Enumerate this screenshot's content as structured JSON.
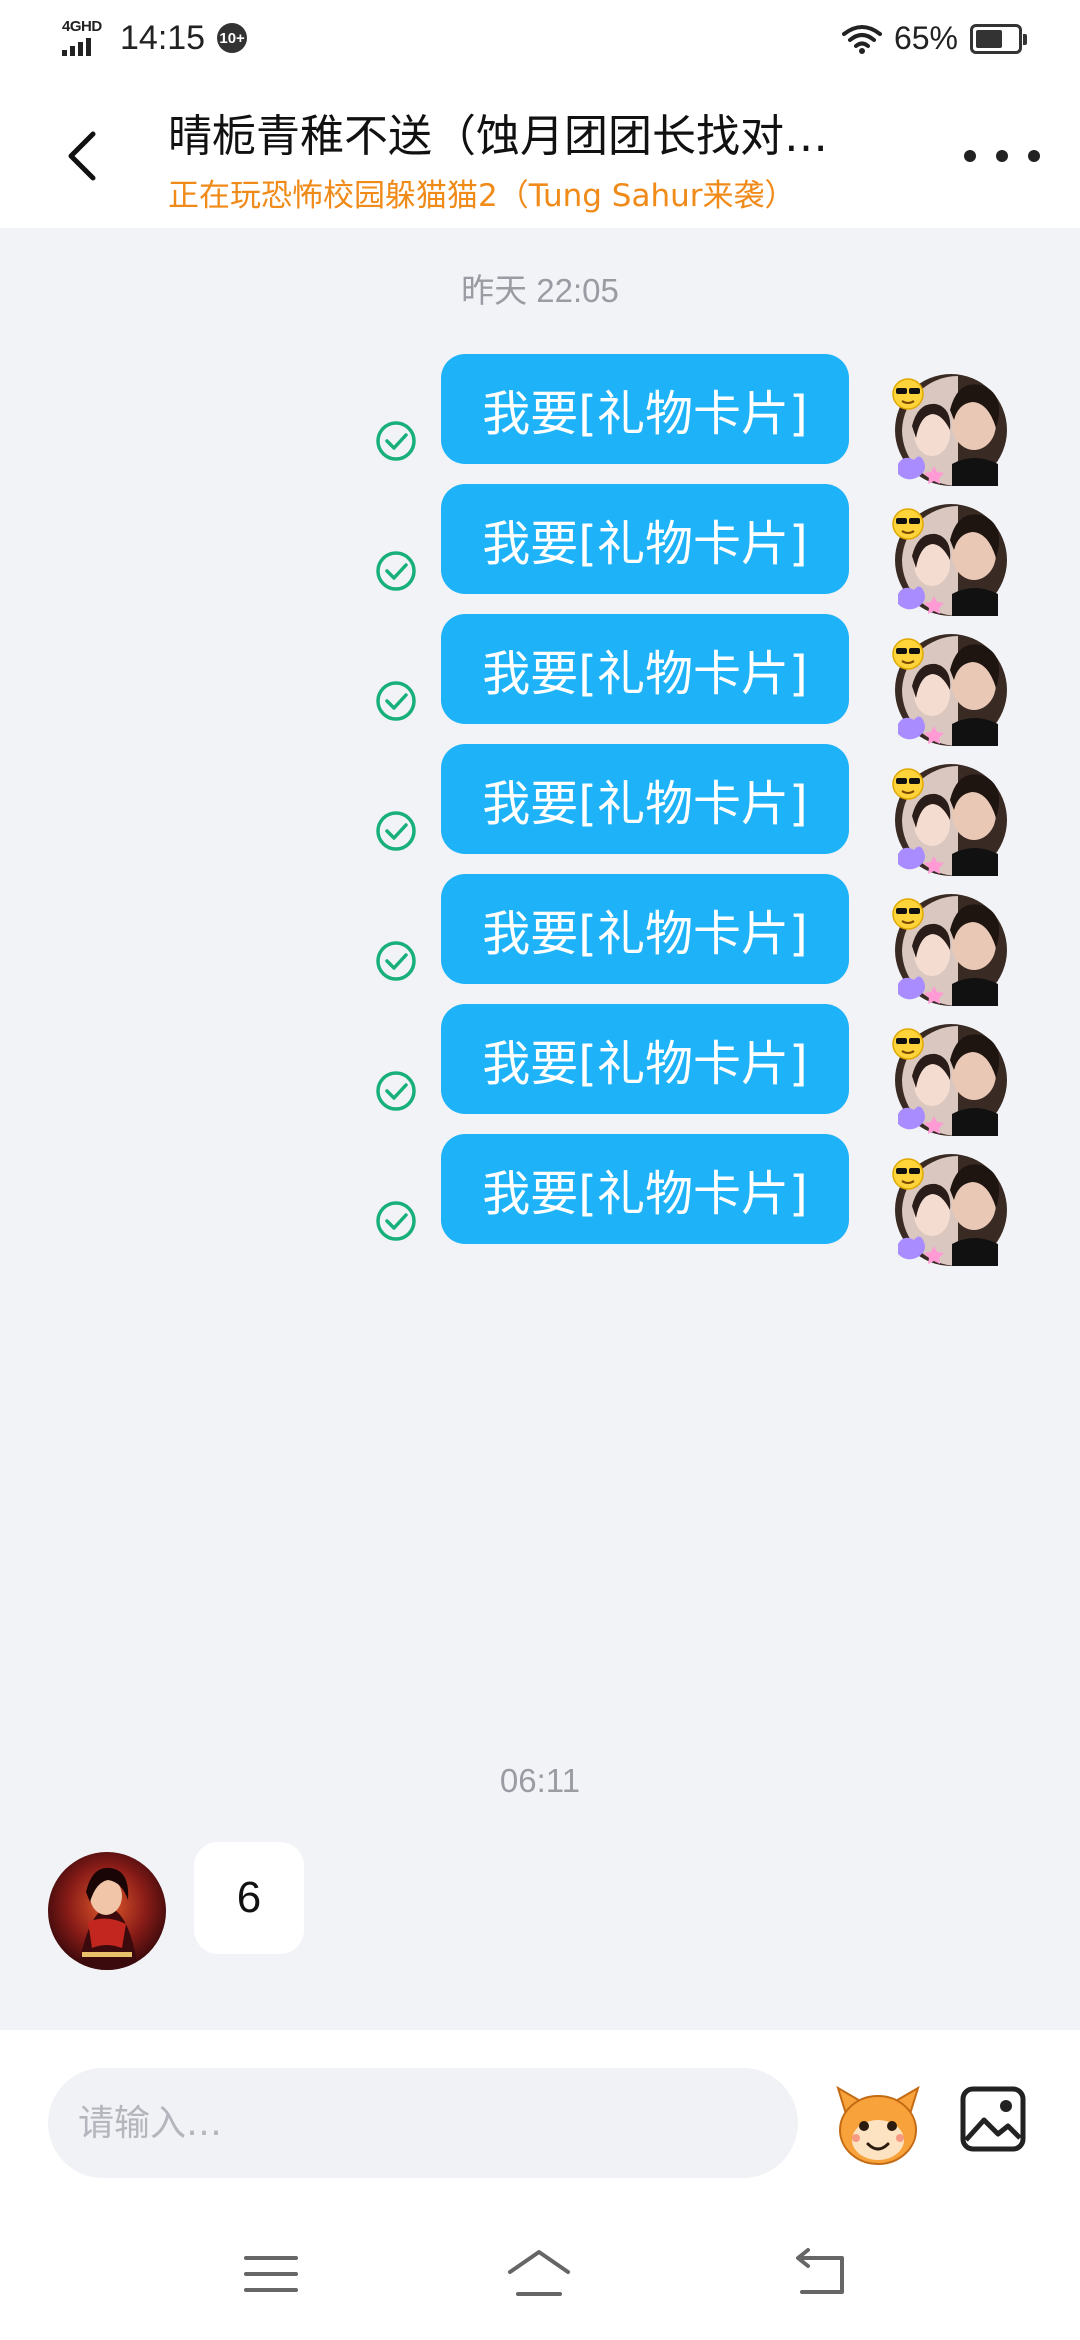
{
  "status_bar": {
    "network": "4GHD",
    "time": "14:15",
    "notification_count": "10+",
    "battery_percent": "65%",
    "battery_level": 0.65
  },
  "header": {
    "title": "晴栀青稚不送（蚀月团团长找对…",
    "subtitle": "正在玩恐怖校园躲猫猫2（Tung Sahur来袭）",
    "back_icon": "chevron-left-icon",
    "more_icon": "more-dots-icon"
  },
  "conversation": {
    "timestamp_1": "昨天 22:05",
    "outgoing": [
      {
        "text": "我要[礼物卡片]",
        "status": "sent"
      },
      {
        "text": "我要[礼物卡片]",
        "status": "sent"
      },
      {
        "text": "我要[礼物卡片]",
        "status": "sent"
      },
      {
        "text": "我要[礼物卡片]",
        "status": "sent"
      },
      {
        "text": "我要[礼物卡片]",
        "status": "sent"
      },
      {
        "text": "我要[礼物卡片]",
        "status": "sent"
      },
      {
        "text": "我要[礼物卡片]",
        "status": "sent"
      }
    ],
    "timestamp_2": "06:11",
    "incoming": [
      {
        "text": "6"
      }
    ]
  },
  "input": {
    "placeholder": "请输入…",
    "emoji_icon": "mascot-emoji-icon",
    "image_icon": "image-icon"
  },
  "nav": {
    "menu_icon": "menu-icon",
    "home_icon": "home-icon",
    "back_icon": "back-icon"
  },
  "colors": {
    "bubble_out": "#1eb3f8",
    "subtitle": "#f08a19",
    "sent_check": "#18b07a",
    "background": "#f2f3f7"
  }
}
